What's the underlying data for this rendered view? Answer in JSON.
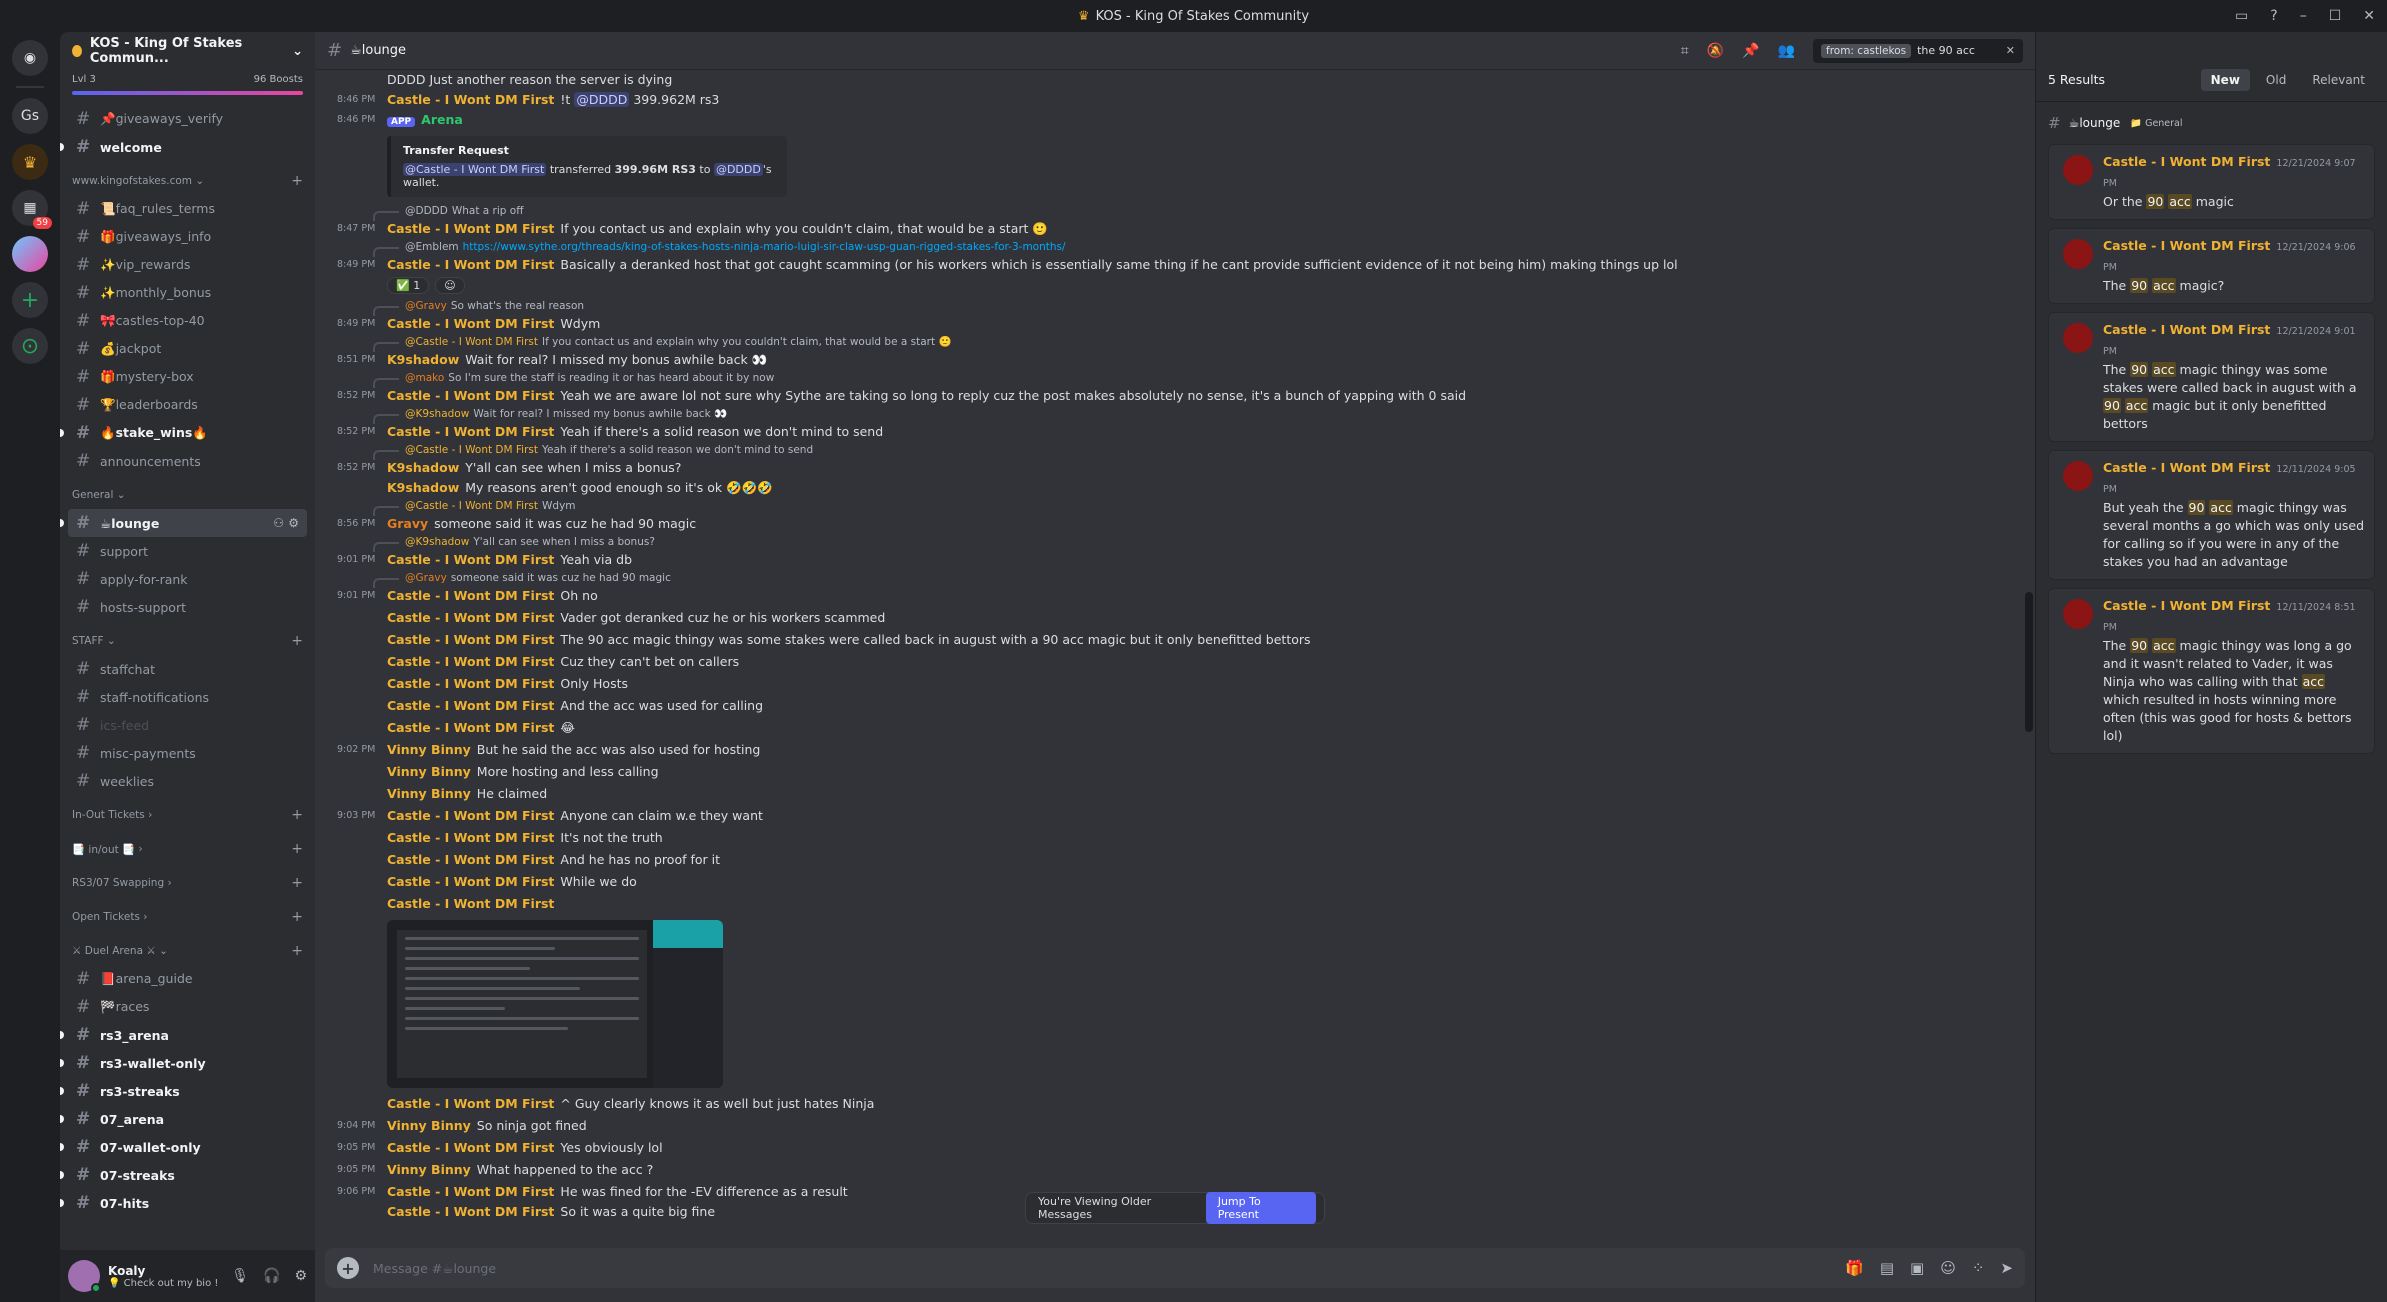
{
  "window": {
    "title": "KOS - King Of Stakes Community"
  },
  "servers": {
    "items": [
      "Gs"
    ],
    "badge": "59"
  },
  "guild": {
    "name": "KOS - King Of Stakes Commun...",
    "level": "Lvl 3",
    "boosts": "96 Boosts"
  },
  "channels": {
    "giveaways_verify": "📌giveaways_verify",
    "welcome": "welcome",
    "cat_site": "www.kingofstakes.com",
    "faq": "📜faq_rules_terms",
    "giveaways_info": "🎁giveaways_info",
    "vip": "✨vip_rewards",
    "monthly": "✨monthly_bonus",
    "castles": "🎀castles-top-40",
    "jackpot": "💰jackpot",
    "mystery": "🎁mystery-box",
    "leaderboards": "🏆leaderboards",
    "stake_wins": "🔥stake_wins🔥",
    "announcements": "announcements",
    "cat_general": "General",
    "lounge": "☕lounge",
    "support": "support",
    "apply": "apply-for-rank",
    "hosts_support": "hosts-support",
    "cat_staff": "STAFF",
    "staffchat": "staffchat",
    "staff_notifications": "staff-notifications",
    "ics_feed": "ics-feed",
    "misc_payments": "misc-payments",
    "weeklies": "weeklies",
    "cat_inout_tickets": "In-Out Tickets",
    "cat_inout": "📑 in/out 📑",
    "cat_swapping": "RS3/07 Swapping",
    "cat_open": "Open Tickets",
    "cat_duel": "⚔ Duel Arena ⚔",
    "arena_guide": "📕arena_guide",
    "races": "🏁races",
    "rs3_arena": "rs3_arena",
    "rs3_wallet": "rs3-wallet-only",
    "rs3_streaks": "rs3-streaks",
    "o7_arena": "07_arena",
    "o7_wallet": "07-wallet-only",
    "o7_streaks": "07-streaks",
    "o7_hits": "07-hits"
  },
  "user": {
    "name": "Koaly",
    "status": "💡 Check out my bio !"
  },
  "header": {
    "channel": "☕lounge",
    "search_chip": "from: castlekos",
    "search_text": "the 90 acc"
  },
  "messages": {
    "m0_text": "DDDD Just another reason the server is dying",
    "m1": {
      "time": "8:46 PM",
      "author": "Castle - I Wont DM First",
      "pre": "!t",
      "mention": "@DDDD",
      "post": "399.962M rs3"
    },
    "m2": {
      "time": "8:46 PM",
      "tag": "APP",
      "author": "Arena"
    },
    "embed": {
      "title": "Transfer Request",
      "mention1": "@Castle - I Wont DM First",
      "mid": "transferred",
      "amount": "399.96M RS3",
      "to": "to",
      "mention2": "@DDDD",
      "end": "'s wallet."
    },
    "r3": {
      "author": "@DDDD",
      "text": "What a rip off"
    },
    "m3": {
      "time": "8:47 PM",
      "author": "Castle - I Wont DM First",
      "text": "If you contact us and explain why you couldn't claim, that would be a start 🙂"
    },
    "r4": {
      "author": "@Emblem",
      "link": "https://www.sythe.org/threads/king-of-stakes-hosts-ninja-mario-luigi-sir-claw-usp-guan-rigged-stakes-for-3-months/"
    },
    "m4": {
      "time": "8:49 PM",
      "author": "Castle - I Wont DM First",
      "text": "Basically a deranked host that got caught scamming (or his workers which is essentially same thing if he cant provide sufficient evidence of it not being him) making things up lol"
    },
    "reaction": "✅ 1",
    "r5": {
      "author": "@Gravy",
      "text": "So what's the real reason"
    },
    "m5": {
      "time": "8:49 PM",
      "author": "Castle - I Wont DM First",
      "text": "Wdym"
    },
    "r6": {
      "author": "@Castle - I Wont DM First",
      "text": "If you contact us and explain why you couldn't claim, that would be a start 🙂"
    },
    "m6": {
      "time": "8:51 PM",
      "author": "K9shadow",
      "text": "Wait for real? I missed my bonus awhile back 👀"
    },
    "r7": {
      "author": "@mako",
      "text": "So I'm sure the staff is reading it or has heard about it by now"
    },
    "m7": {
      "time": "8:52 PM",
      "author": "Castle - I Wont DM First",
      "text": "Yeah we are aware lol not sure why Sythe are taking so long to reply cuz the post makes absolutely no sense, it's a bunch of yapping with 0 said"
    },
    "r8": {
      "author": "@K9shadow",
      "text": "Wait for real? I missed my bonus awhile back 👀"
    },
    "m8": {
      "time": "8:52 PM",
      "author": "Castle - I Wont DM First",
      "text": "Yeah if there's a solid reason we don't mind to send"
    },
    "r9": {
      "author": "@Castle - I Wont DM First",
      "text": "Yeah if there's a solid reason we don't mind to send"
    },
    "m9": {
      "time": "8:52 PM",
      "author": "K9shadow",
      "text": "Y'all can see when I miss a bonus?"
    },
    "m10": {
      "author": "K9shadow",
      "text": "My reasons aren't good enough so it's ok 🤣🤣🤣"
    },
    "r11": {
      "author": "@Castle - I Wont DM First",
      "text": "Wdym"
    },
    "m11": {
      "time": "8:56 PM",
      "author": "Gravy",
      "text": "someone said it was cuz he had 90 magic"
    },
    "r12": {
      "author": "@K9shadow",
      "text": "Y'all can see when I miss a bonus?"
    },
    "m12": {
      "time": "9:01 PM",
      "author": "Castle - I Wont DM First",
      "text": "Yeah via db"
    },
    "r13": {
      "author": "@Gravy",
      "text": "someone said it was cuz he had 90 magic"
    },
    "m13": {
      "time": "9:01 PM",
      "author": "Castle - I Wont DM First",
      "text": "Oh no"
    },
    "m14": {
      "author": "Castle - I Wont DM First",
      "text": "Vader got deranked cuz he or his workers scammed"
    },
    "m15": {
      "author": "Castle - I Wont DM First",
      "text": "The 90 acc magic thingy was some stakes were called back in august with a 90 acc magic but it only benefitted bettors"
    },
    "m16": {
      "author": "Castle - I Wont DM First",
      "text": "Cuz they can't bet on callers"
    },
    "m17": {
      "author": "Castle - I Wont DM First",
      "text": "Only Hosts"
    },
    "m18": {
      "author": "Castle - I Wont DM First",
      "text": "And the acc was used for calling"
    },
    "m19": {
      "author": "Castle - I Wont DM First",
      "text": "😂"
    },
    "m20": {
      "time": "9:02 PM",
      "author": "Vinny Binny",
      "text": "But he said the acc was also used for hosting"
    },
    "m21": {
      "author": "Vinny Binny",
      "text": "More hosting and less calling"
    },
    "m22": {
      "author": "Vinny Binny",
      "text": "He claimed"
    },
    "m23": {
      "time": "9:03 PM",
      "author": "Castle - I Wont DM First",
      "text": "Anyone can claim w.e they want"
    },
    "m24": {
      "author": "Castle - I Wont DM First",
      "text": "It's not the truth"
    },
    "m25": {
      "author": "Castle - I Wont DM First",
      "text": "And he has no proof for it"
    },
    "m26": {
      "author": "Castle - I Wont DM First",
      "text": "While we do"
    },
    "m27": {
      "author": "Castle - I Wont DM First",
      "text": ""
    },
    "m28": {
      "author": "Castle - I Wont DM First",
      "text": "^ Guy clearly knows it as well but just hates Ninja"
    },
    "m29": {
      "time": "9:04 PM",
      "author": "Vinny Binny",
      "text": "So ninja got fined"
    },
    "m30": {
      "time": "9:05 PM",
      "author": "Castle - I Wont DM First",
      "text": "Yes obviously lol"
    },
    "m31": {
      "time": "9:05 PM",
      "author": "Vinny Binny",
      "text": "What happened to the acc ?"
    },
    "m32": {
      "time": "9:06 PM",
      "author": "Castle - I Wont DM First",
      "text": "He was fined for the -EV difference as a result"
    },
    "m33": {
      "author": "Castle - I Wont DM First",
      "text": "So it was a quite big fine"
    }
  },
  "older": {
    "text": "You're Viewing Older Messages",
    "button": "Jump To Present"
  },
  "composer": {
    "placeholder": "Message #☕lounge"
  },
  "results": {
    "count": "5 Results",
    "tabs": [
      "New",
      "Old",
      "Relevant"
    ],
    "channel": "☕lounge",
    "category": "📁 General",
    "items": [
      {
        "author": "Castle - I Wont DM First",
        "time": "12/21/2024 9:07 PM",
        "pre": "Or the",
        "h1": "90",
        "h2": "acc",
        "post": "magic"
      },
      {
        "author": "Castle - I Wont DM First",
        "time": "12/21/2024 9:06 PM",
        "pre": "The",
        "h1": "90",
        "h2": "acc",
        "post": "magic?"
      },
      {
        "author": "Castle - I Wont DM First",
        "time": "12/21/2024 9:01 PM",
        "pre": "The",
        "h1": "90",
        "h2": "acc",
        "mid": "magic thingy was some stakes were called back in august with a",
        "h3": "90",
        "h4": "acc",
        "post": "magic but it only benefitted bettors"
      },
      {
        "author": "Castle - I Wont DM First",
        "time": "12/11/2024 9:05 PM",
        "pre": "But yeah the",
        "h1": "90",
        "h2": "acc",
        "post": "magic thingy was several months a go which was only used for calling so if you were in any of the stakes you had an advantage"
      },
      {
        "author": "Castle - I Wont DM First",
        "time": "12/11/2024 8:51 PM",
        "pre": "The",
        "h1": "90",
        "h2": "acc",
        "mid": "magic thingy was long a go and it wasn't related to Vader, it was Ninja who was calling with that",
        "h3": "acc",
        "post": "which resulted in hosts winning more often (this was good for hosts & bettors lol)"
      }
    ]
  }
}
